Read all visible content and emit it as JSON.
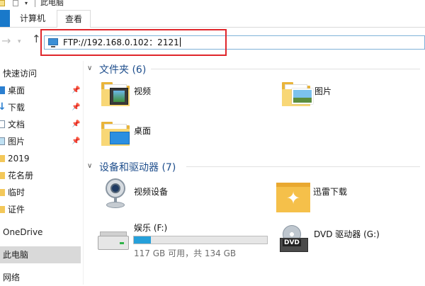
{
  "window": {
    "title": "此电脑"
  },
  "ribbon": {
    "tabs": [
      {
        "label": "计算机"
      },
      {
        "label": "查看"
      }
    ]
  },
  "address": {
    "value": "FTP://192.168.0.102：2121"
  },
  "sidebar": {
    "quick_access": "快速访问",
    "items": [
      {
        "label": "桌面",
        "icon": "desktop-icon",
        "pinned": true
      },
      {
        "label": "下载",
        "icon": "download-icon",
        "pinned": true
      },
      {
        "label": "文档",
        "icon": "document-icon",
        "pinned": true
      },
      {
        "label": "图片",
        "icon": "picture-icon",
        "pinned": true
      },
      {
        "label": "2019",
        "icon": "folder-icon",
        "pinned": false
      },
      {
        "label": "花名册",
        "icon": "folder-icon",
        "pinned": false
      },
      {
        "label": "临时",
        "icon": "folder-icon",
        "pinned": false
      },
      {
        "label": "证件",
        "icon": "folder-icon",
        "pinned": false
      }
    ],
    "onedrive": "OneDrive",
    "this_pc": "此电脑",
    "network": "网络"
  },
  "folders": {
    "heading": "文件夹 (6)",
    "items": [
      {
        "label": "视频"
      },
      {
        "label": "图片"
      },
      {
        "label": "桌面"
      }
    ]
  },
  "devices": {
    "heading": "设备和驱动器 (7)",
    "items": [
      {
        "label": "视频设备"
      },
      {
        "label": "迅雷下载"
      },
      {
        "label": "娱乐 (F:)",
        "free_text": "117 GB 可用，共 134 GB",
        "used_fraction": 0.127
      },
      {
        "label": "DVD 驱动器 (G:)",
        "badge": "DVD"
      }
    ]
  },
  "colors": {
    "accent": "#1979ca",
    "highlight_box": "#e0262b",
    "usage_fill": "#26a0da",
    "section_title": "#1e4e8c"
  }
}
